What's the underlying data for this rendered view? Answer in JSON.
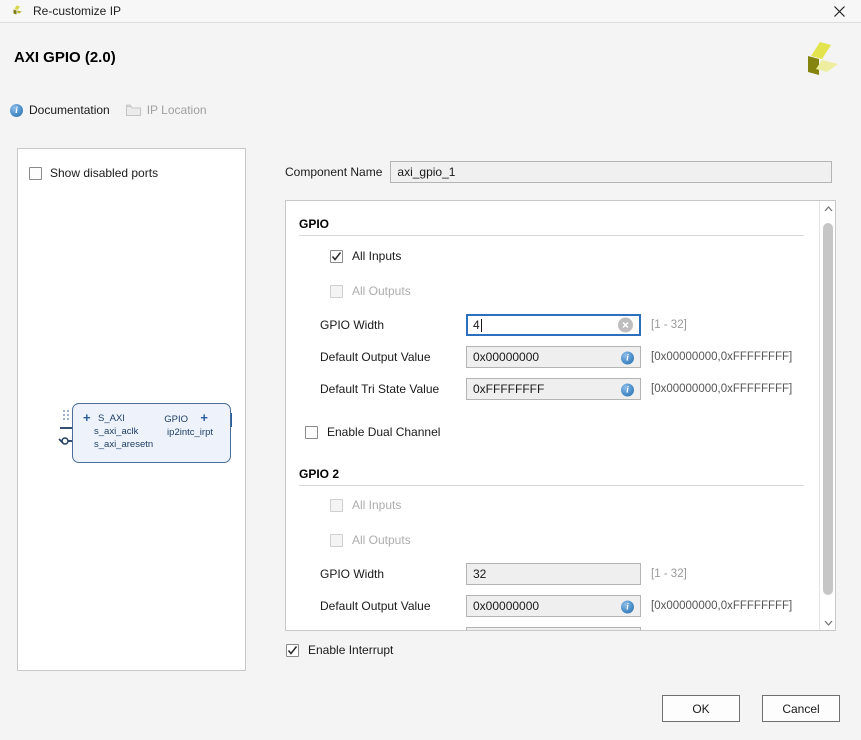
{
  "window": {
    "title": "Re-customize IP",
    "icon": "xilinx-logo-icon",
    "close_label": "✕"
  },
  "header": {
    "ip_title": "AXI GPIO (2.0)",
    "logo": "xilinx-logo",
    "links": [
      {
        "label": "Documentation",
        "icon": "info-icon",
        "enabled": true
      },
      {
        "label": "IP Location",
        "icon": "folder-icon",
        "enabled": false
      }
    ]
  },
  "preview": {
    "show_disabled_ports": {
      "label": "Show disabled ports",
      "checked": false
    },
    "block": {
      "left_ports": [
        "S_AXI",
        "s_axi_aclk",
        "s_axi_aresetn"
      ],
      "right_ports": [
        "GPIO",
        "ip2intc_irpt"
      ]
    }
  },
  "form": {
    "component_name": {
      "label": "Component Name",
      "value": "axi_gpio_1"
    },
    "groups": [
      {
        "title": "GPIO",
        "all_inputs": {
          "label": "All Inputs",
          "checked": true,
          "enabled": true
        },
        "all_outputs": {
          "label": "All Outputs",
          "checked": false,
          "enabled": false
        },
        "gpio_width": {
          "label": "GPIO Width",
          "value": "4",
          "range": "[1 - 32]",
          "focused": true
        },
        "default_output_value": {
          "label": "Default Output Value",
          "value": "0x00000000",
          "range": "[0x00000000,0xFFFFFFFF]"
        },
        "default_tri_state_value": {
          "label": "Default Tri State Value",
          "value": "0xFFFFFFFF",
          "range": "[0x00000000,0xFFFFFFFF]"
        },
        "enable_dual_channel": {
          "label": "Enable Dual Channel",
          "checked": false
        }
      },
      {
        "title": "GPIO 2",
        "all_inputs": {
          "label": "All Inputs",
          "checked": false,
          "enabled": false
        },
        "all_outputs": {
          "label": "All Outputs",
          "checked": false,
          "enabled": false
        },
        "gpio_width": {
          "label": "GPIO Width",
          "value": "32",
          "range": "[1 - 32]",
          "focused": false
        },
        "default_output_value": {
          "label": "Default Output Value",
          "value": "0x00000000",
          "range": "[0x00000000,0xFFFFFFFF]"
        }
      }
    ]
  },
  "footer": {
    "enable_interrupt": {
      "label": "Enable Interrupt",
      "checked": true
    },
    "ok_label": "OK",
    "cancel_label": "Cancel"
  },
  "colors": {
    "accent_blue": "#2c6fbd",
    "info_blue": "#2b5c9c",
    "logo_yellow": "#e8e84a",
    "logo_olive": "#8a8a16",
    "block_fill": "#eef3fb",
    "block_border": "#4a6d99"
  }
}
